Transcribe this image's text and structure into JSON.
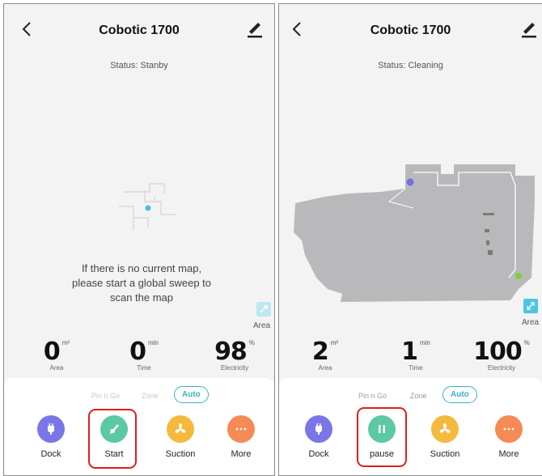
{
  "left": {
    "title": "Cobotic 1700",
    "status": "Status: Stanby",
    "message_lines": [
      "If there is no current map,",
      "please start a global sweep to",
      "scan the map"
    ],
    "area_label": "Area",
    "stats": [
      {
        "value": "0",
        "unit": "m²",
        "label": "Area"
      },
      {
        "value": "0",
        "unit": "min",
        "label": "Time"
      },
      {
        "value": "98",
        "unit": "%",
        "label": "Electricity"
      }
    ],
    "modes": [
      "Pin n Go",
      "Zone",
      "Auto"
    ],
    "active_mode": "Auto",
    "actions": [
      {
        "label": "Dock",
        "icon": "plug-icon",
        "color": "#7b76e8"
      },
      {
        "label": "Start",
        "icon": "sweep-icon",
        "color": "#5cc9a3"
      },
      {
        "label": "Suction",
        "icon": "fan-icon",
        "color": "#f5b93d"
      },
      {
        "label": "More",
        "icon": "more-dots-icon",
        "color": "#f58a54"
      }
    ]
  },
  "right": {
    "title": "Cobotic 1700",
    "status": "Status: Cleaning",
    "area_label": "Area",
    "stats": [
      {
        "value": "2",
        "unit": "m²",
        "label": "Area"
      },
      {
        "value": "1",
        "unit": "min",
        "label": "Time"
      },
      {
        "value": "100",
        "unit": "%",
        "label": "Electricity"
      }
    ],
    "modes": [
      "Pin n Go",
      "Zone",
      "Auto"
    ],
    "active_mode": "Auto",
    "actions": [
      {
        "label": "Dock",
        "icon": "plug-icon",
        "color": "#7b76e8"
      },
      {
        "label": "pause",
        "icon": "pause-icon",
        "color": "#5cc9a3"
      },
      {
        "label": "Suction",
        "icon": "fan-icon",
        "color": "#f5b93d"
      },
      {
        "label": "More",
        "icon": "more-dots-icon",
        "color": "#f58a54"
      }
    ]
  },
  "colors": {
    "accent": "#3ab0c8",
    "highlight": "#e01e1e",
    "map": "#b9b9bb"
  }
}
